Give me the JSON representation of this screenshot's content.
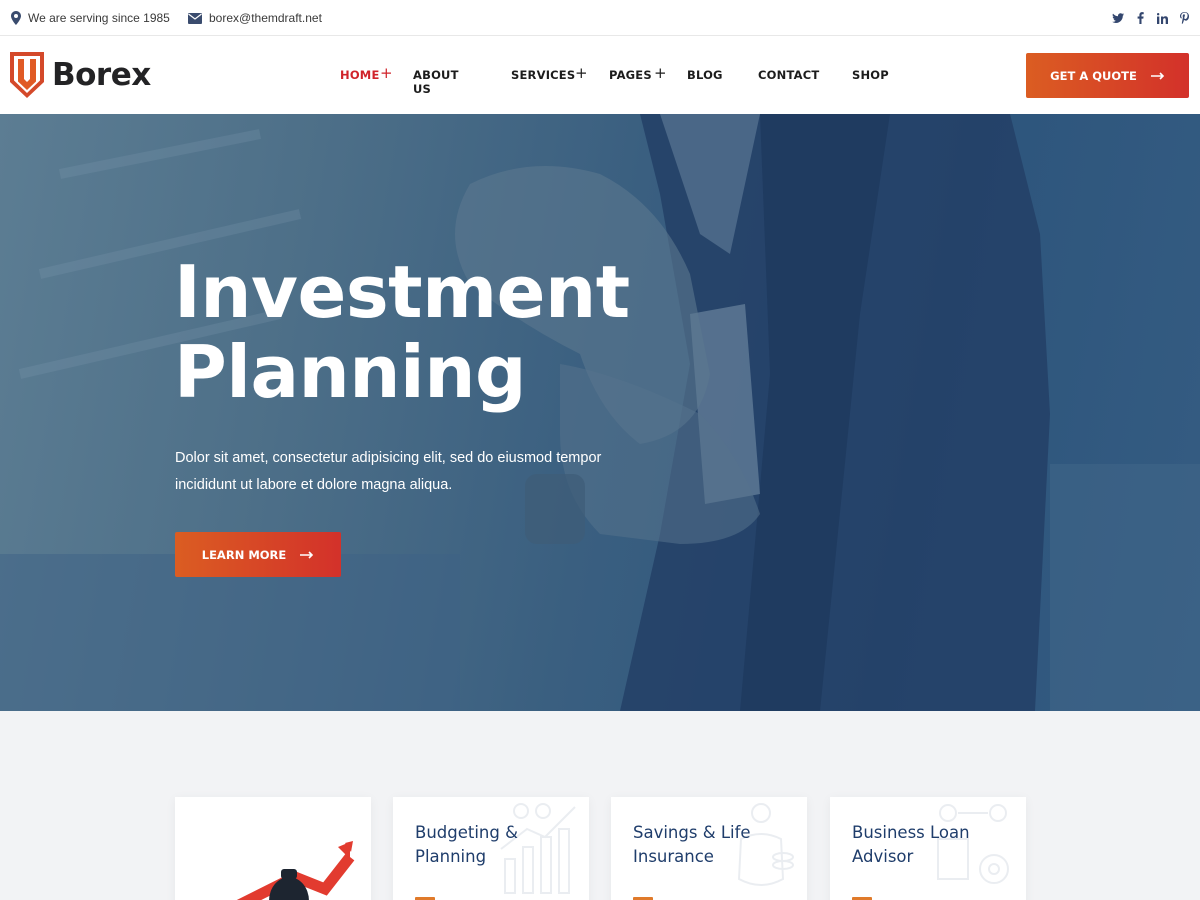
{
  "topbar": {
    "location_text": "We are serving since 1985",
    "email_text": "borex@themdraft.net",
    "social_icons": [
      "twitter-icon",
      "facebook-icon",
      "linkedin-icon",
      "pinterest-icon"
    ]
  },
  "header": {
    "logo_text": "Borex",
    "nav": [
      {
        "label": "HOME",
        "has_submenu": true,
        "active": true
      },
      {
        "label": "ABOUT US",
        "has_submenu": false,
        "active": false
      },
      {
        "label": "SERVICES",
        "has_submenu": true,
        "active": false
      },
      {
        "label": "PAGES",
        "has_submenu": true,
        "active": false
      },
      {
        "label": "BLOG",
        "has_submenu": false,
        "active": false
      },
      {
        "label": "CONTACT",
        "has_submenu": false,
        "active": false
      },
      {
        "label": "SHOP",
        "has_submenu": false,
        "active": false
      }
    ],
    "cta_label": "GET A QUOTE"
  },
  "hero": {
    "title_line1": "Investment",
    "title_line2": "Planning",
    "description_line1": "Dolor sit amet, consectetur adipisicing elit, sed do eiusmod tempor",
    "description_line2": "incididunt ut labore et dolore magna aliqua.",
    "button_label": "LEARN MORE"
  },
  "services": {
    "cards": [
      {
        "title_line1": "",
        "title_line2": "",
        "icon": "money-bag-growth-icon"
      },
      {
        "title_line1": "Budgeting &",
        "title_line2": "Planning",
        "icon": "budget-chart-icon"
      },
      {
        "title_line1": "Savings & Life",
        "title_line2": "Insurance",
        "icon": "savings-icon"
      },
      {
        "title_line1": "Business Loan",
        "title_line2": "Advisor",
        "icon": "business-loan-icon"
      }
    ]
  },
  "colors": {
    "accent_red": "#d0232a",
    "accent_orange": "#db5d22",
    "navy": "#1f3d6b",
    "hero_overlay": "#2d557c"
  }
}
